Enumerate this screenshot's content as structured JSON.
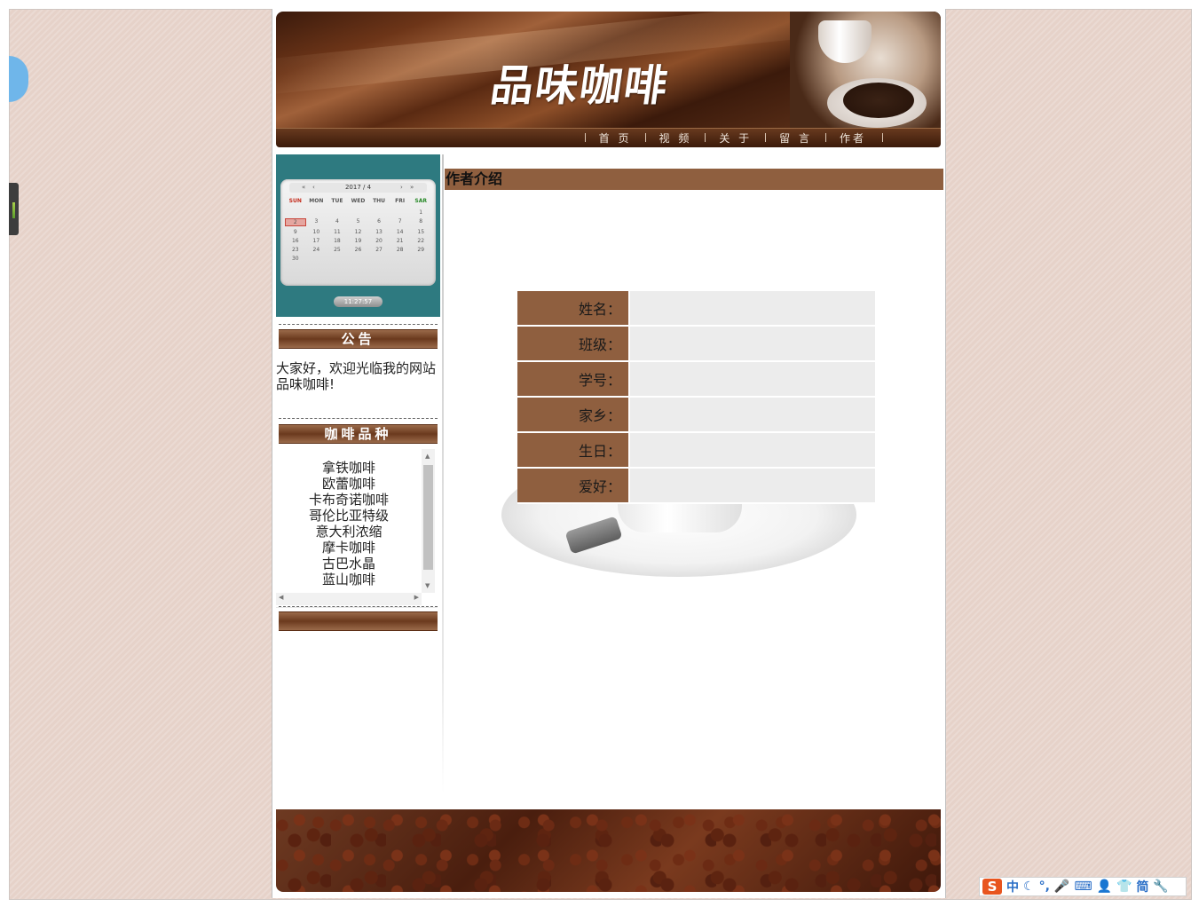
{
  "header": {
    "site_title": "品味咖啡",
    "nav": [
      "首 页",
      "视 频",
      "关 于",
      "留 言",
      "作者"
    ]
  },
  "sidebar": {
    "calendar": {
      "month_label": "2017 / 4",
      "prev_year": "«",
      "prev_month": "‹",
      "next_month": "›",
      "next_year": "»",
      "weekdays": [
        "SUN",
        "MON",
        "TUE",
        "WED",
        "THU",
        "FRI",
        "SAR"
      ],
      "days": [
        "",
        "",
        "",
        "",
        "",
        "",
        "1",
        "2",
        "3",
        "4",
        "5",
        "6",
        "7",
        "8",
        "9",
        "10",
        "11",
        "12",
        "13",
        "14",
        "15",
        "16",
        "17",
        "18",
        "19",
        "20",
        "21",
        "22",
        "23",
        "24",
        "25",
        "26",
        "27",
        "28",
        "29",
        "30"
      ],
      "today": "2",
      "clock": "11:27:57"
    },
    "notice_title": "公告",
    "notice_text_line1": "大家好，欢迎光临我的网站",
    "notice_text_line2": "品味咖啡!",
    "varieties_title": "咖啡品种",
    "varieties": [
      "拿铁咖啡",
      "欧蕾咖啡",
      "卡布奇诺咖啡",
      "哥伦比亚特级",
      "意大利浓缩",
      "摩卡咖啡",
      "古巴水晶",
      "蓝山咖啡"
    ]
  },
  "main": {
    "title": "作者介绍",
    "fields": [
      {
        "label": "姓名：",
        "value": ""
      },
      {
        "label": "班级：",
        "value": ""
      },
      {
        "label": "学号：",
        "value": ""
      },
      {
        "label": "家乡：",
        "value": ""
      },
      {
        "label": "生日：",
        "value": ""
      },
      {
        "label": "爱好：",
        "value": ""
      }
    ]
  },
  "ime": {
    "logo": "S",
    "lang": "中",
    "mode": "简"
  }
}
